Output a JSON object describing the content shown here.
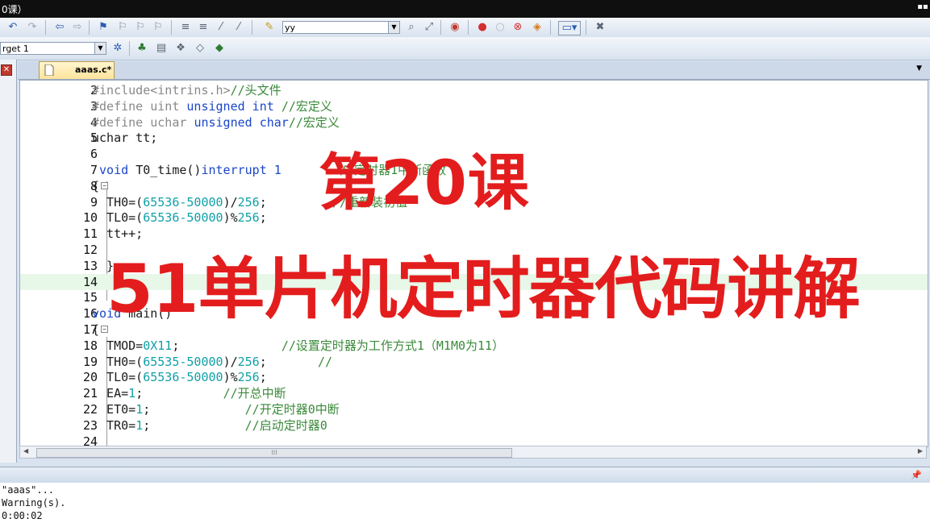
{
  "window": {
    "title": "0课）"
  },
  "toolbar": {
    "find_value": "yy",
    "target_value": "rget 1"
  },
  "editor": {
    "tab_label": "aaas.c*",
    "lines": [
      {
        "n": "2",
        "segs": [
          [
            "pp",
            "#include<intrins.h>"
          ],
          [
            "cm",
            "//头文件"
          ]
        ]
      },
      {
        "n": "3",
        "segs": [
          [
            "pp",
            "#define uint "
          ],
          [
            "kw",
            "unsigned int "
          ],
          [
            "cm",
            "//宏定义"
          ]
        ]
      },
      {
        "n": "4",
        "segs": [
          [
            "pp",
            "#define uchar "
          ],
          [
            "kw",
            "unsigned char"
          ],
          [
            "cm",
            "//宏定义"
          ]
        ]
      },
      {
        "n": "5",
        "segs": [
          [
            "",
            "uchar tt;"
          ]
        ]
      },
      {
        "n": "6",
        "segs": []
      },
      {
        "n": "7",
        "segs": [
          [
            "kw",
            " void "
          ],
          [
            "",
            "T0_time()"
          ],
          [
            "kw",
            "interrupt 1"
          ],
          [
            "",
            "        "
          ],
          [
            "cm",
            "//定时器1中断函数"
          ]
        ]
      },
      {
        "n": "8",
        "fold": "⊟",
        "segs": [
          [
            "",
            ""
          ],
          [
            "",
            ""
          ],
          [
            "",
            "{"
          ]
        ]
      },
      {
        "n": "9",
        "segs": [
          [
            "",
            "  TH0=("
          ],
          [
            "num",
            "65536-50000"
          ],
          [
            "",
            ")/"
          ],
          [
            "num",
            "256"
          ],
          [
            "",
            ";"
          ],
          [
            "",
            "         "
          ],
          [
            "cm",
            "//重新装初值"
          ]
        ]
      },
      {
        "n": "10",
        "segs": [
          [
            "",
            "  TL0=("
          ],
          [
            "num",
            "65536-50000"
          ],
          [
            "",
            ")%"
          ],
          [
            "num",
            "256"
          ],
          [
            "",
            ";"
          ]
        ]
      },
      {
        "n": "11",
        "segs": [
          [
            "",
            "  tt++;"
          ]
        ]
      },
      {
        "n": "12",
        "segs": []
      },
      {
        "n": "13",
        "segs": [
          [
            "",
            "  }"
          ]
        ]
      },
      {
        "n": "14",
        "hl": true,
        "segs": []
      },
      {
        "n": "15",
        "segs": []
      },
      {
        "n": "16",
        "segs": [
          [
            "kw",
            "void "
          ],
          [
            "",
            "main()"
          ]
        ]
      },
      {
        "n": "17",
        "fold": "⊟",
        "segs": [
          [
            "",
            "{"
          ]
        ]
      },
      {
        "n": "18",
        "segs": [
          [
            "",
            "  TMOD="
          ],
          [
            "num",
            "0X11"
          ],
          [
            "",
            ";"
          ],
          [
            "",
            "              "
          ],
          [
            "cm",
            "//设置定时器为工作方式1（M1M0为11）"
          ]
        ]
      },
      {
        "n": "19",
        "segs": [
          [
            "",
            "  TH0=("
          ],
          [
            "num",
            "65535-50000"
          ],
          [
            "",
            ")/"
          ],
          [
            "num",
            "256"
          ],
          [
            "",
            ";"
          ],
          [
            "",
            "       "
          ],
          [
            "cm",
            "//"
          ]
        ]
      },
      {
        "n": "20",
        "segs": [
          [
            "",
            "  TL0=("
          ],
          [
            "num",
            "65536-50000"
          ],
          [
            "",
            ")%"
          ],
          [
            "num",
            "256"
          ],
          [
            "",
            ";"
          ]
        ]
      },
      {
        "n": "21",
        "segs": [
          [
            "",
            "  EA="
          ],
          [
            "num",
            "1"
          ],
          [
            "",
            ";"
          ],
          [
            "",
            "           "
          ],
          [
            "cm",
            "//开总中断"
          ]
        ]
      },
      {
        "n": "22",
        "segs": [
          [
            "",
            "  ET0="
          ],
          [
            "num",
            "1"
          ],
          [
            "",
            ";"
          ],
          [
            "",
            "             "
          ],
          [
            "cm",
            "//开定时器0中断"
          ]
        ]
      },
      {
        "n": "23",
        "segs": [
          [
            "",
            "  TR0="
          ],
          [
            "num",
            "1"
          ],
          [
            "",
            ";"
          ],
          [
            "",
            "             "
          ],
          [
            "cm",
            "//启动定时器0"
          ]
        ]
      },
      {
        "n": "24",
        "segs": []
      }
    ]
  },
  "overlay": {
    "line1": "第20课",
    "line2": "51单片机定时器代码讲解"
  },
  "output": {
    "lines": [
      "\"aaas\"...",
      "Warning(s).",
      "0:00:02"
    ]
  },
  "colors": {
    "overlay_red": "#e31d1d",
    "keyword_blue": "#1b46c9",
    "comment_green": "#3a8a3a",
    "number_teal": "#10a0a8"
  }
}
